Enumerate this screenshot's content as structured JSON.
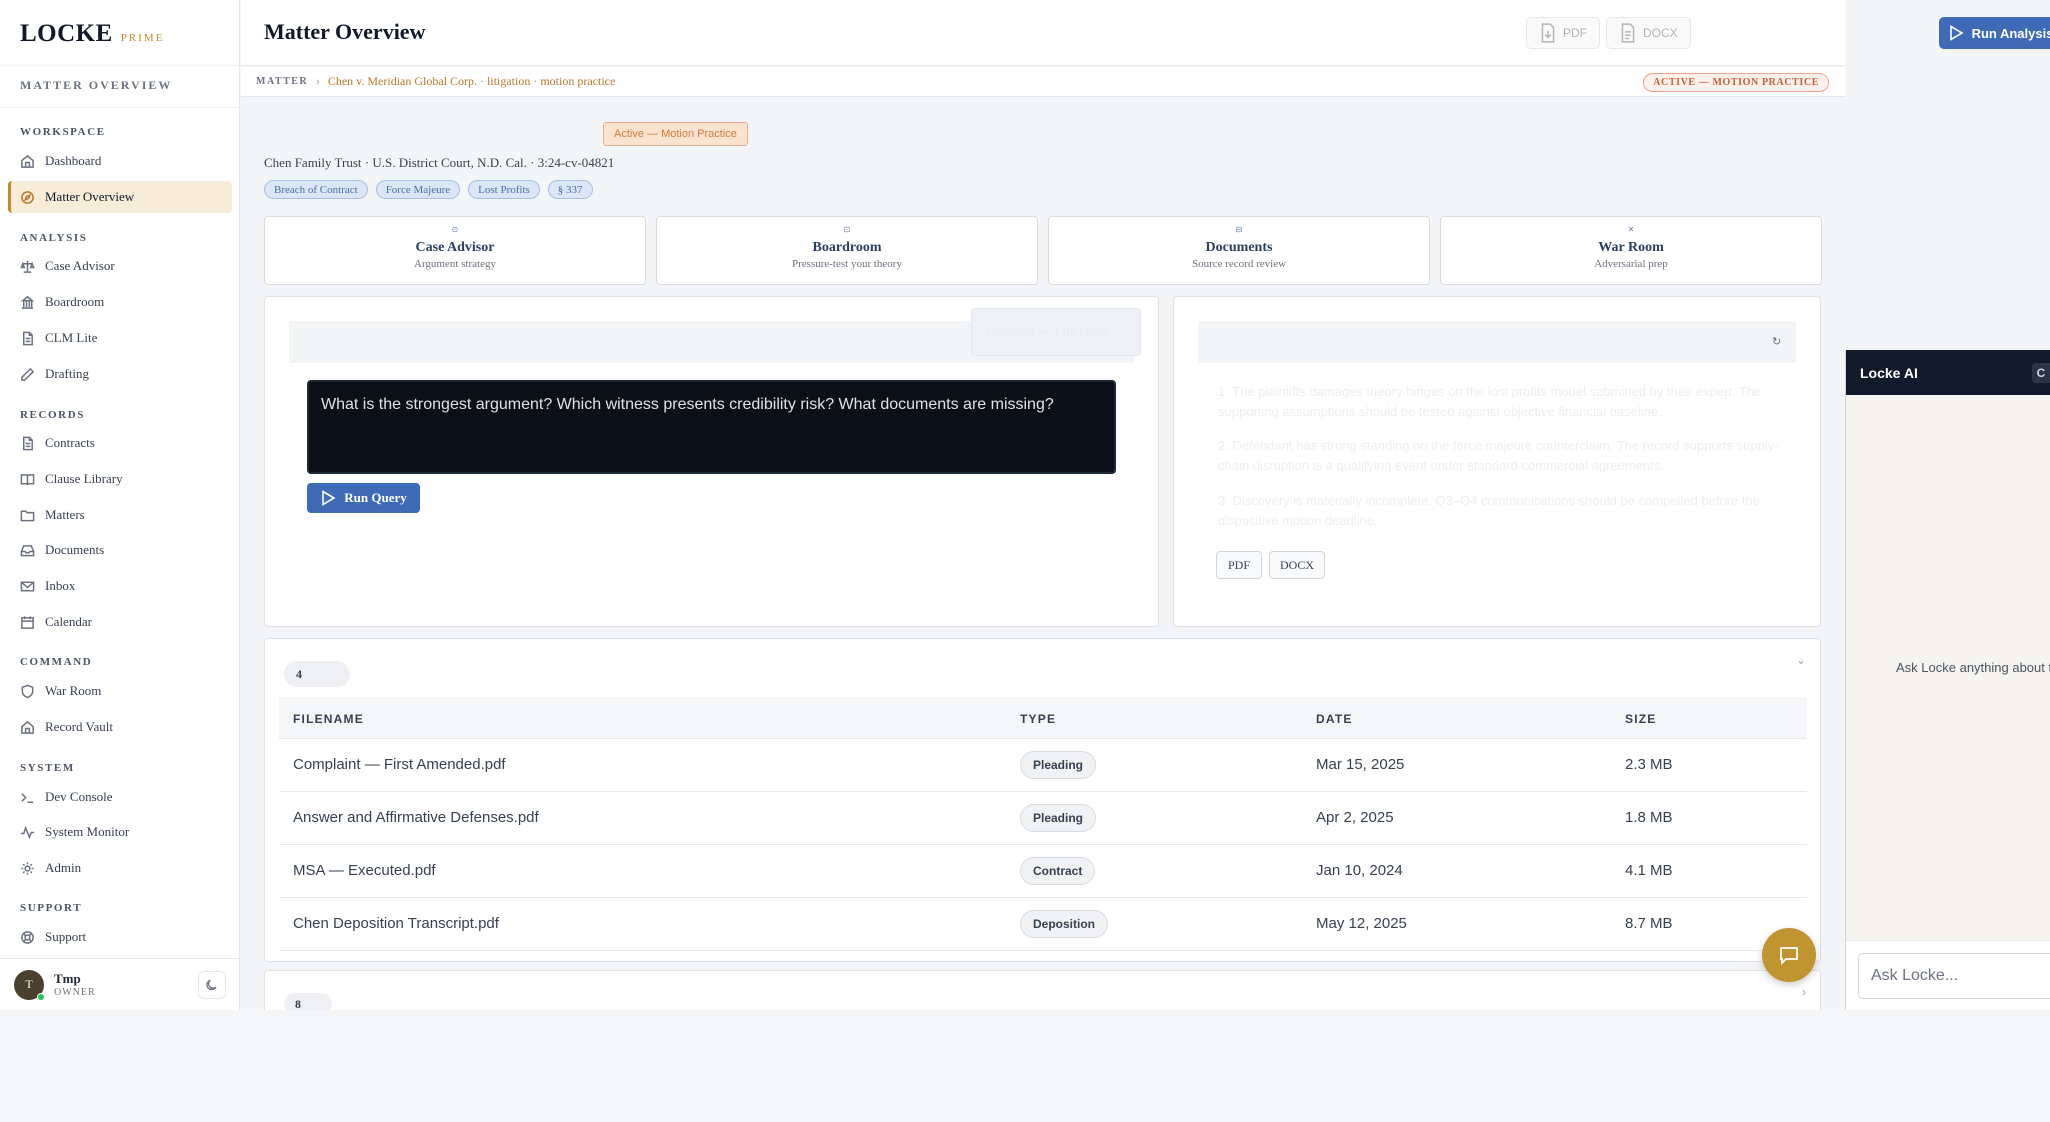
{
  "brand": {
    "name": "LOCKE",
    "tier": "PRIME"
  },
  "sidebar": {
    "page_label": "MATTER OVERVIEW",
    "sections": [
      {
        "title": "WORKSPACE"
      },
      {
        "title": "ANALYSIS"
      },
      {
        "title": "RECORDS"
      },
      {
        "title": "COMMAND"
      },
      {
        "title": "SYSTEM"
      },
      {
        "title": "SUPPORT"
      }
    ],
    "items": [
      {
        "label": "Dashboard",
        "icon": "home-icon"
      },
      {
        "label": "Matter Overview",
        "icon": "compass-icon"
      },
      {
        "label": "Case Advisor",
        "icon": "scale-icon"
      },
      {
        "label": "Boardroom",
        "icon": "building-icon"
      },
      {
        "label": "CLM Lite",
        "icon": "file-icon"
      },
      {
        "label": "Drafting",
        "icon": "pen-icon"
      },
      {
        "label": "Contracts",
        "icon": "file-icon"
      },
      {
        "label": "Clause Library",
        "icon": "book-icon"
      },
      {
        "label": "Matters",
        "icon": "folder-icon"
      },
      {
        "label": "Documents",
        "icon": "inbox-tray-icon"
      },
      {
        "label": "Inbox",
        "icon": "mail-icon"
      },
      {
        "label": "Calendar",
        "icon": "calendar-icon"
      },
      {
        "label": "War Room",
        "icon": "shield-icon"
      },
      {
        "label": "Record Vault",
        "icon": "vault-icon"
      },
      {
        "label": "Dev Console",
        "icon": "terminal-icon"
      },
      {
        "label": "System Monitor",
        "icon": "activity-icon"
      },
      {
        "label": "Admin",
        "icon": "gear-icon"
      },
      {
        "label": "Support",
        "icon": "lifebuoy-icon"
      }
    ],
    "user": {
      "initial": "T",
      "name": "Tmp",
      "role": "OWNER"
    }
  },
  "header": {
    "title": "Matter Overview",
    "pdf_label": "PDF",
    "docx_label": "DOCX",
    "run_label": "Run Analysis"
  },
  "breadcrumb": {
    "key": "MATTER",
    "value": "Chen v. Meridian Global Corp. · litigation · motion practice",
    "status": "ACTIVE — MOTION PRACTICE"
  },
  "matter": {
    "status_pill": "Active — Motion Practice",
    "subtitle": "Chen Family Trust · U.S. District Court, N.D. Cal. · 3:24-cv-04821",
    "tags": [
      "Breach of Contract",
      "Force Majeure",
      "Lost Profits",
      "§ 337"
    ]
  },
  "cards": [
    {
      "title": "Case Advisor",
      "sub": "Argument strategy",
      "icon": "⊙"
    },
    {
      "title": "Boardroom",
      "sub": "Pressure-test your theory",
      "icon": "⊡"
    },
    {
      "title": "Documents",
      "sub": "Source record review",
      "icon": "⊟"
    },
    {
      "title": "War Room",
      "sub": "Adversarial prep",
      "icon": "✕"
    }
  ],
  "query": {
    "text": "What is the strongest argument? Which witness presents credibility risk? What documents are missing?",
    "run_label": "Run Query",
    "ghost_button": "Proceed — Full Case"
  },
  "answer": {
    "points": [
      "The plaintiffs damages theory hinges on the lost profits model submitted by their expert. The supporting assumptions should be tested against objective financial baseline.",
      "Defendant has strong standing on the force majeure counterclaim. The record supports supply-chain disruption is a qualifying event under standard commercial agreements.",
      "Discovery is materially incomplete. Q3–Q4 communications should be compelled before the dispositive motion deadline."
    ],
    "pdf_label": "PDF",
    "docx_label": "DOCX"
  },
  "documents": {
    "count": "4",
    "columns": [
      "FILENAME",
      "TYPE",
      "DATE",
      "SIZE"
    ],
    "rows": [
      {
        "filename": "Complaint — First Amended.pdf",
        "type": "Pleading",
        "date": "Mar 15, 2025",
        "size": "2.3 MB"
      },
      {
        "filename": "Answer and Affirmative Defenses.pdf",
        "type": "Pleading",
        "date": "Apr 2, 2025",
        "size": "1.8 MB"
      },
      {
        "filename": "MSA — Executed.pdf",
        "type": "Contract",
        "date": "Jan 10, 2024",
        "size": "4.1 MB"
      },
      {
        "filename": "Chen Deposition Transcript.pdf",
        "type": "Deposition",
        "date": "May 12, 2025",
        "size": "8.7 MB"
      }
    ],
    "next_count": "8"
  },
  "chat": {
    "title": "Locke AI",
    "empty_text": "Ask Locke anything about t",
    "placeholder": "Ask Locke..."
  },
  "colors": {
    "accent": "#3f6ab5",
    "gold": "#c19432",
    "status": "#c2623b"
  }
}
